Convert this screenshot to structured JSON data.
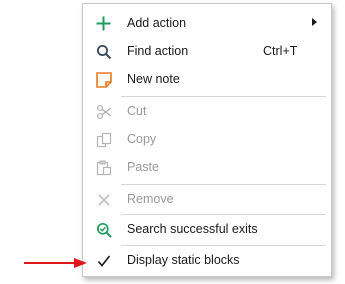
{
  "context_menu": {
    "items": [
      {
        "label": "Add action",
        "icon": "plus-icon",
        "has_submenu": true,
        "enabled": true
      },
      {
        "label": "Find action",
        "shortcut": "Ctrl+T",
        "icon": "search-icon",
        "enabled": true
      },
      {
        "label": "New note",
        "icon": "note-icon",
        "enabled": true
      },
      {
        "label": "Cut",
        "icon": "scissors-icon",
        "enabled": false
      },
      {
        "label": "Copy",
        "icon": "copy-icon",
        "enabled": false
      },
      {
        "label": "Paste",
        "icon": "paste-icon",
        "enabled": false
      },
      {
        "label": "Remove",
        "icon": "x-icon",
        "enabled": false
      },
      {
        "label": "Search successful exits",
        "icon": "search-check-icon",
        "enabled": true
      },
      {
        "label": "Display static blocks",
        "icon": "checkmark-icon",
        "checked": true,
        "enabled": true
      }
    ]
  },
  "colors": {
    "plus_icon": "#1e9e5c",
    "note_icon": "#e8791f",
    "search_check_icon": "#1e9e5c",
    "disabled_text": "#9a9a9a",
    "annotation_arrow": "#e0141b"
  }
}
